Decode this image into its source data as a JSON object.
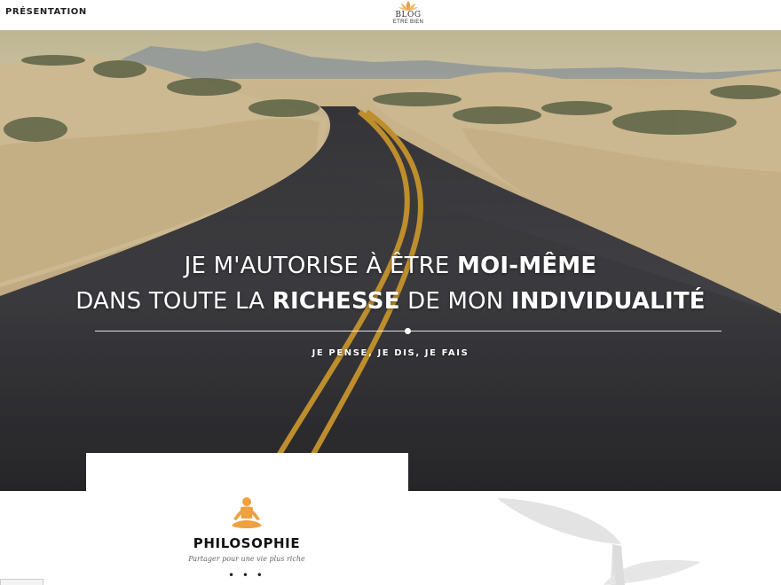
{
  "nav": {
    "presentation_label": "PRÉSENTATION"
  },
  "logo": {
    "line1": "BLOG",
    "line2": "ETRE BIEN",
    "icon": "lotus-icon",
    "color": "#e8a04a"
  },
  "hero": {
    "line1_normal": "JE M'AUTORISE À ÊTRE ",
    "line1_bold": "MOI-MÊME",
    "line2_part1": "DANS TOUTE LA ",
    "line2_bold1": "RICHESSE",
    "line2_part2": " DE MON ",
    "line2_bold2": "INDIVIDUALITÉ",
    "tagline": "JE PENSE, JE DIS, JE FAIS"
  },
  "section": {
    "icon": "meditation-icon",
    "title": "PHILOSOPHIE",
    "subtitle": "Partager pour une vie plus riche",
    "dots": "• • •",
    "accent": "#f0a040"
  }
}
